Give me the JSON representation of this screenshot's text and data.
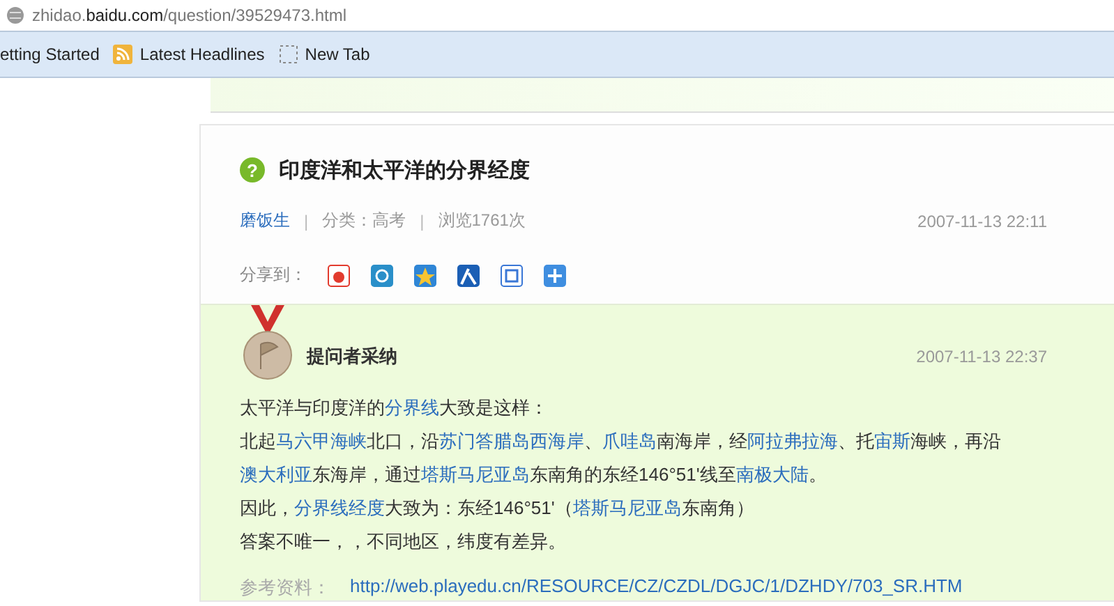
{
  "address_bar": {
    "host_prefix": "zhidao.",
    "host_main": "baidu.com",
    "path": "/question/39529473.html"
  },
  "bookmarks": [
    {
      "kind": "plain",
      "label": "etting Started"
    },
    {
      "kind": "feed",
      "label": "Latest Headlines"
    },
    {
      "kind": "blank",
      "label": "New Tab"
    }
  ],
  "question": {
    "icon_char": "?",
    "title": "印度洋和太平洋的分界经度",
    "author": "磨饭生",
    "separators": [
      "|",
      "|"
    ],
    "category": "分类：高考",
    "views": "浏览1761次",
    "time": "2007-11-13 22:11",
    "share_label": "分享到："
  },
  "share_icons": [
    {
      "kind": "weibo",
      "color": "#e23b2e"
    },
    {
      "kind": "p",
      "color": "#2a8fc9"
    },
    {
      "kind": "star",
      "color": "#2f86d6"
    },
    {
      "kind": "person",
      "color": "#1b5fb5"
    },
    {
      "kind": "tie",
      "color": "#3a77d6"
    },
    {
      "kind": "plus",
      "color": "#3f8ee0"
    }
  ],
  "answer": {
    "badge": "提问者采纳",
    "time": "2007-11-13 22:37",
    "paragraphs": [
      [
        {
          "text": "太平洋与印度洋的",
          "link": false
        },
        {
          "text": "分界线",
          "link": true
        },
        {
          "text": "大致是这样：",
          "link": false
        }
      ],
      [
        {
          "text": "北起",
          "link": false
        },
        {
          "text": "马六甲海峡",
          "link": true
        },
        {
          "text": "北口，沿",
          "link": false
        },
        {
          "text": "苏门答腊岛",
          "link": true
        },
        {
          "text": "西海岸",
          "link": true
        },
        {
          "text": "、",
          "link": false
        },
        {
          "text": "爪哇岛",
          "link": true
        },
        {
          "text": "南海岸，经",
          "link": false
        },
        {
          "text": "阿拉弗拉海",
          "link": true
        },
        {
          "text": "、托",
          "link": false
        },
        {
          "text": "宙斯",
          "link": true
        },
        {
          "text": "海峡，再沿",
          "link": false
        },
        {
          "text": "澳大利亚",
          "link": true
        },
        {
          "text": "东海岸，通过",
          "link": false
        },
        {
          "text": "塔斯马尼亚岛",
          "link": true
        },
        {
          "text": "东南角的东经146°51'线至",
          "link": false
        },
        {
          "text": "南极大陆",
          "link": true
        },
        {
          "text": "。",
          "link": false
        }
      ],
      [
        {
          "text": "因此，",
          "link": false
        },
        {
          "text": "分界线经度",
          "link": true
        },
        {
          "text": "大致为：东经146°51'（",
          "link": false
        },
        {
          "text": "塔斯马尼亚岛",
          "link": true
        },
        {
          "text": "东南角）",
          "link": false
        }
      ],
      [
        {
          "text": "答案不唯一，，不同地区，纬度有差异。",
          "link": false
        }
      ]
    ],
    "reference_label": "参考资料：",
    "reference_url": "http://web.playedu.cn/RESOURCE/CZ/CZDL/DGJC/1/DZHDY/703_SR.HTM"
  }
}
